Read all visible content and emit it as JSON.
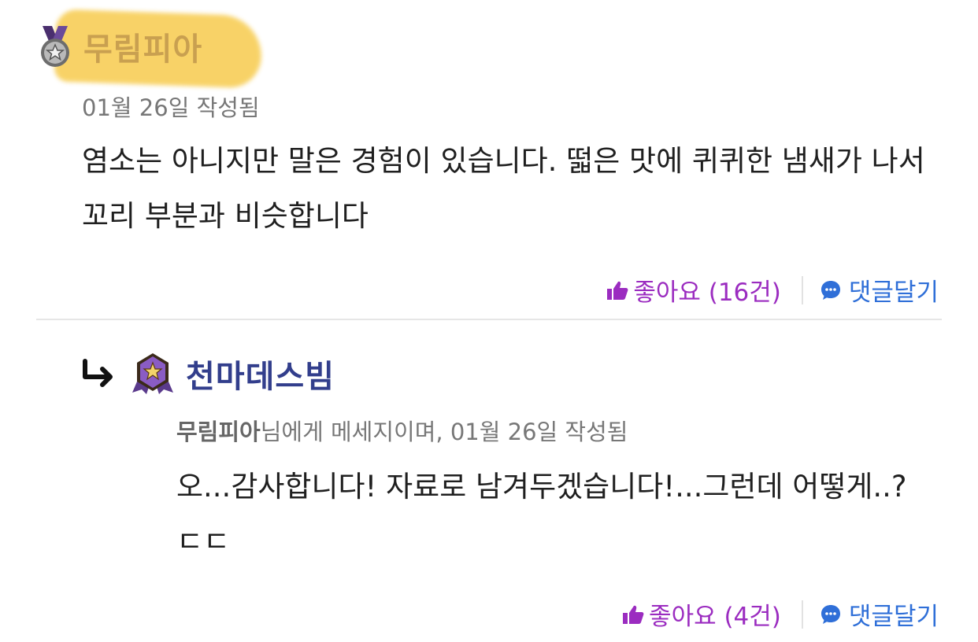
{
  "colors": {
    "like": "#9b2cc0",
    "reply": "#2f6fd8",
    "author_reply": "#323e8c",
    "highlight": "#f7cb4d"
  },
  "comments": [
    {
      "author": "무림피아",
      "badge_icon": "bronze-star-medal-icon",
      "meta": "01월 26일 작성됨",
      "text": "염소는 아니지만 말은 경험이 있습니다. 떫은 맛에 퀴퀴한 냄새가 나서 꼬리 부분과 비슷합니다",
      "like_label": "좋아요 (16건)",
      "reply_label": "댓글달기"
    },
    {
      "author": "천마데스빔",
      "badge_icon": "purple-star-badge-icon",
      "mention": "무림피아",
      "meta_suffix": "님에게 메세지이며, 01월 26일 작성됨",
      "text": "오...감사합니다! 자료로 남겨두겠습니다!...그런데 어떻게..?ㄷㄷ",
      "like_label": "좋아요 (4건)",
      "reply_label": "댓글달기"
    }
  ]
}
